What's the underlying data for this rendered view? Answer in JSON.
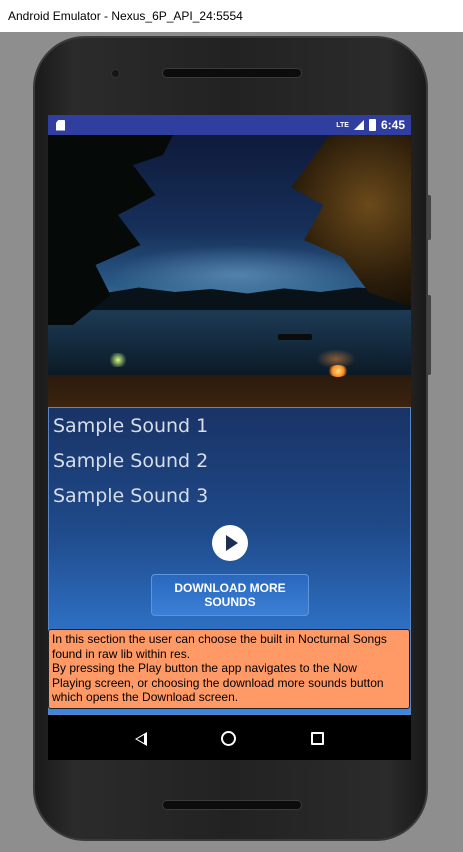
{
  "window": {
    "title": "Android Emulator - Nexus_6P_API_24:5554"
  },
  "statusbar": {
    "time": "6:45",
    "network": "LTE"
  },
  "sounds": [
    {
      "label": "Sample Sound 1"
    },
    {
      "label": "Sample Sound 2"
    },
    {
      "label": "Sample Sound 3"
    }
  ],
  "controls": {
    "download_label": "DOWNLOAD MORE SOUNDS"
  },
  "info": {
    "lines": [
      "In this section the user can choose the built in Nocturnal Songs",
      "found in raw lib within res.",
      " By pressing the Play button the app navigates to the Now",
      "Playing screen, or choosing the download more sounds button",
      "which opens the Download screen."
    ]
  },
  "icons": {
    "statusbar_left": "sd-card-icon",
    "play": "play-icon",
    "nav": [
      "back-icon",
      "home-icon",
      "recents-icon"
    ]
  },
  "colors": {
    "statusbar": "#303f9f",
    "panel_top": "#193366",
    "panel_bottom": "#3b86de",
    "info_box": "#ff9966",
    "download_button": "#2a67be"
  }
}
